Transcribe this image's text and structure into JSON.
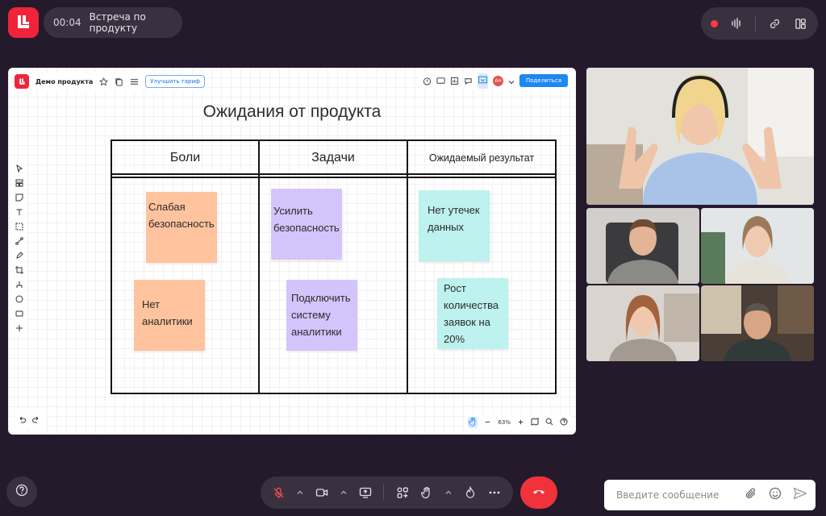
{
  "meeting": {
    "elapsed": "00:04",
    "title": "Встреча по продукту"
  },
  "board": {
    "name": "Демо продукта",
    "upgrade_label": "Улучшить тариф",
    "share_label": "Поделиться",
    "avatar_initials": "АН",
    "zoom": "63%",
    "heading": "Ожидания от продукта",
    "columns": [
      "Боли",
      "Задачи",
      "Ожидаемый результат"
    ],
    "notes": [
      {
        "text": "Слабая безопасность",
        "color": "#ffc39e"
      },
      {
        "text": "Нет аналитики",
        "color": "#ffc39e"
      },
      {
        "text": "Усилить безопасность",
        "color": "#d4c4fb"
      },
      {
        "text": "Подключить систему аналитики",
        "color": "#d4c4fb"
      },
      {
        "text": "Нет утечек данных",
        "color": "#bdf2ee"
      },
      {
        "text": "Рост количества заявок на 20%",
        "color": "#bdf2ee"
      }
    ]
  },
  "chat": {
    "placeholder": "Введите сообщение"
  },
  "colors": {
    "brand": "#f0233b",
    "background": "#241a2c",
    "hangup": "#f0323b",
    "share": "#1e88f0"
  },
  "icons": [
    "mic-off-icon",
    "camera-icon",
    "screen-share-icon",
    "apps-icon",
    "hand-icon",
    "reaction-icon",
    "more-icon",
    "hangup-icon",
    "record-icon",
    "audio-icon",
    "link-icon",
    "layout-icon",
    "help-icon",
    "attach-icon",
    "emoji-icon",
    "send-icon"
  ]
}
